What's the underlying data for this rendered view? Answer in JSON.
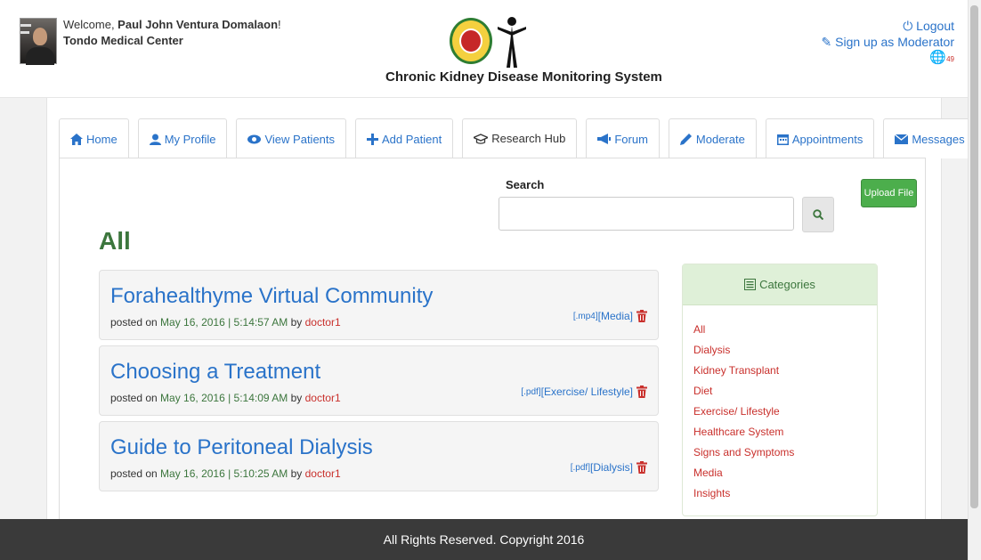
{
  "header": {
    "welcome_prefix": "Welcome, ",
    "user_name": "Paul John Ventura Domalaon",
    "welcome_suffix": "!",
    "organization": "Tondo Medical Center",
    "site_title": "Chronic Kidney Disease Monitoring System",
    "logout": "Logout",
    "signup_moderator": "Sign up as Moderator",
    "notif_count": "49"
  },
  "tabs": [
    {
      "label": "Home",
      "icon": "home-icon"
    },
    {
      "label": "My Profile",
      "icon": "user-icon"
    },
    {
      "label": "View Patients",
      "icon": "eye-icon"
    },
    {
      "label": "Add Patient",
      "icon": "plus-icon"
    },
    {
      "label": "Research Hub",
      "icon": "graduation-cap-icon"
    },
    {
      "label": "Forum",
      "icon": "bullhorn-icon"
    },
    {
      "label": "Moderate",
      "icon": "pencil-icon"
    },
    {
      "label": "Appointments",
      "icon": "calendar-icon"
    },
    {
      "label": "Messages",
      "icon": "envelope-icon"
    }
  ],
  "search": {
    "label": "Search",
    "placeholder": ""
  },
  "upload_label": "Upload File",
  "section_title": "All",
  "posts": [
    {
      "title": "Forahealthyme Virtual Community",
      "posted_on": "posted on ",
      "date": "May 16, 2016 | 5:14:57 AM",
      "by": " by ",
      "author": "doctor1",
      "ext": "[.mp4]",
      "category": "[Media]"
    },
    {
      "title": "Choosing a Treatment",
      "posted_on": "posted on ",
      "date": "May 16, 2016 | 5:14:09 AM",
      "by": " by ",
      "author": "doctor1",
      "ext": "[.pdf]",
      "category": "[Exercise/ Lifestyle]"
    },
    {
      "title": "Guide to Peritoneal Dialysis",
      "posted_on": "posted on ",
      "date": "May 16, 2016 | 5:10:25 AM",
      "by": " by ",
      "author": "doctor1",
      "ext": "[.pdf]",
      "category": "[Dialysis]"
    }
  ],
  "categories": {
    "heading": "Categories",
    "items": [
      "All",
      "Dialysis",
      "Kidney Transplant",
      "Diet",
      "Exercise/ Lifestyle",
      "Healthcare System",
      "Signs and Symptoms",
      "Media",
      "Insights"
    ]
  },
  "footer": "All Rights Reserved. Copyright 2016",
  "colors": {
    "link": "#2a73c9",
    "green": "#3c763d",
    "red": "#c9302c",
    "upload": "#4cae4c",
    "footer": "#3a3a3a"
  }
}
